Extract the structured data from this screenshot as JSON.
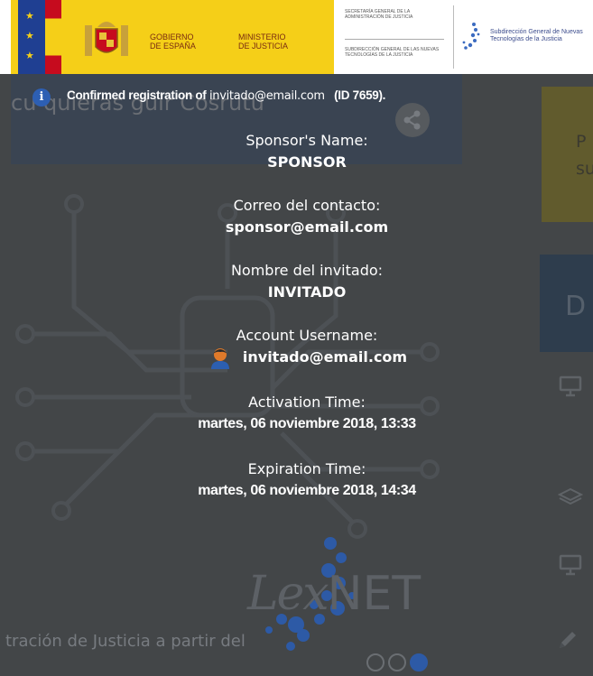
{
  "header": {
    "gobierno": "GOBIERNO\nDE ESPAÑA",
    "ministerio": "MINISTERIO\nDE JUSTICIA",
    "secretaria": "SECRETARÍA GENERAL DE LA ADMINISTRACIÓN DE JUSTICIA",
    "subdireccion": "SUBDIRECCIÓN GENERAL DE LAS NUEVAS TECNOLOGÍAS DE LA JUSTICIA",
    "subdireccion_logo_text": "Subdirección General de Nuevas Tecnologías de la Justicia"
  },
  "background": {
    "title_fragment": "cu quieras guir Cosrutu",
    "yellow_panel_text": "P\nsu",
    "blue_panel_text": "D",
    "bottom_text": "tración de Justicia a partir del",
    "logo_lex": "Lex",
    "logo_net": "NET"
  },
  "notice": {
    "prefix": "Confirmed registration of",
    "email": "invitado@email.com",
    "id": "(ID 7659)."
  },
  "details": {
    "sponsor_name_label": "Sponsor's Name:",
    "sponsor_name_value": "SPONSOR",
    "contact_email_label": "Correo del contacto:",
    "contact_email_value": "sponsor@email.com",
    "guest_name_label": "Nombre del invitado:",
    "guest_name_value": "INVITADO",
    "account_username_label": "Account Username:",
    "account_username_value": "invitado@email.com",
    "activation_time_label": "Activation Time:",
    "activation_time_value": "martes, 06 noviembre 2018, 13:33",
    "expiration_time_label": "Expiration Time:",
    "expiration_time_value": "martes, 06 noviembre 2018, 14:34"
  },
  "icons": {
    "info": "info-icon",
    "user": "user-avatar-icon",
    "share": "share-icon",
    "monitor": "monitor-icon",
    "layers": "layers-icon",
    "pencil": "pencil-icon"
  },
  "colors": {
    "overlay": "#434648",
    "gov_yellow": "#f5cf18",
    "info_blue": "#2d5fb3",
    "logo_blue": "#2d5aa6"
  }
}
